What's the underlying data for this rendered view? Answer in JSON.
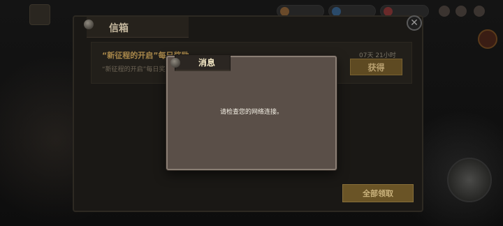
{
  "mailbox": {
    "title": "信箱",
    "close_symbol": "✕",
    "mail_item": {
      "title": "“新征程的开启”每日奖励",
      "subtitle": "“新征程的开启”每日奖励",
      "time_left": "07天 21小时",
      "claim_label": "获得"
    },
    "claim_all_label": "全部领取"
  },
  "dialog": {
    "title": "消息",
    "message": "请检查您的网络连接。"
  },
  "icons": {
    "pin": "pin-icon",
    "close": "close-icon"
  },
  "colors": {
    "dialog_bg": "#5a4f48",
    "claim_button": "#5e4a22",
    "claim_all_button": "#6a5426",
    "dialog_title": "#f5e9c6"
  }
}
